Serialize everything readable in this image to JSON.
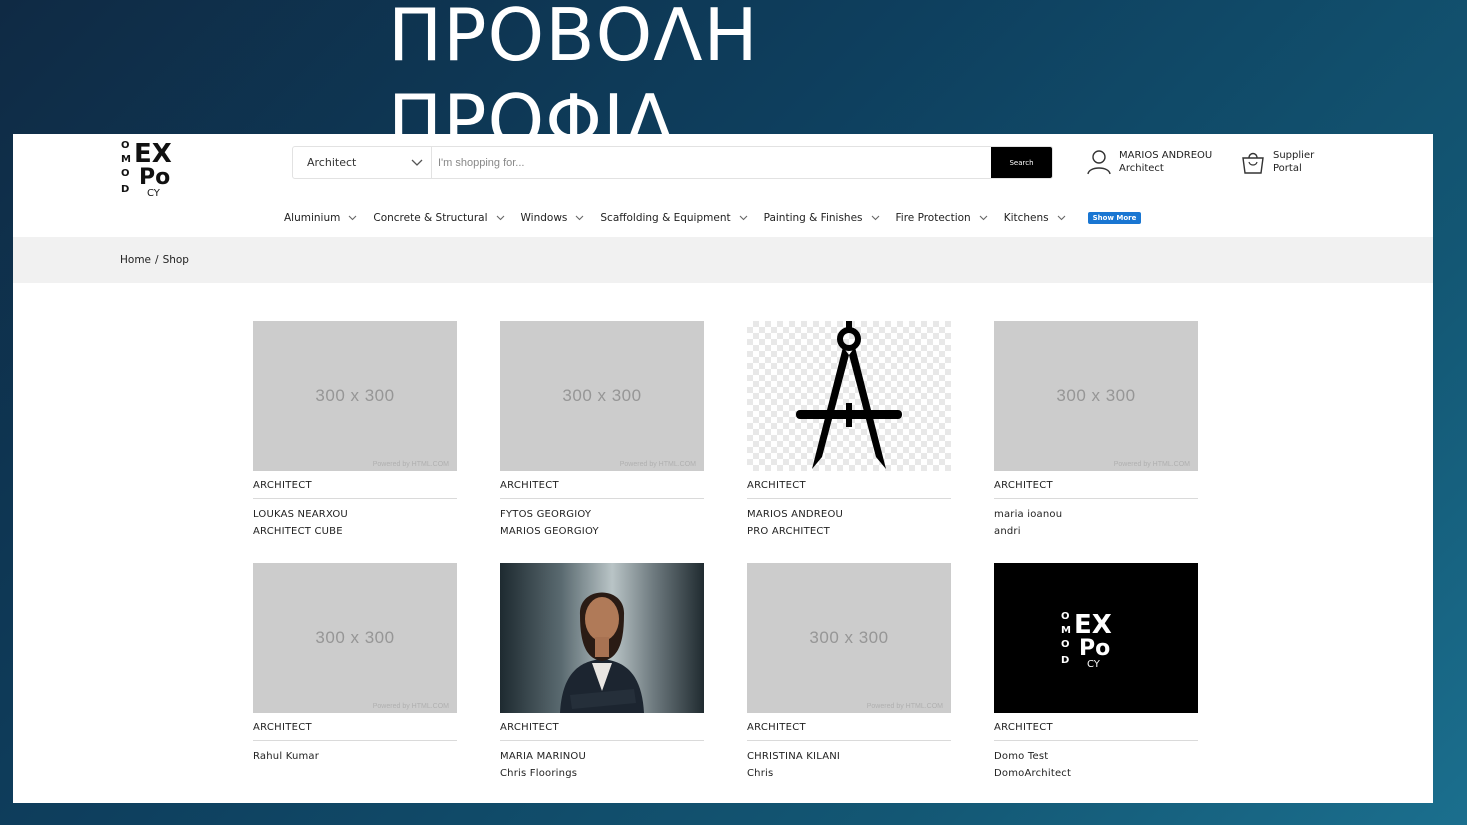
{
  "slide": {
    "title_line1": "ΠΡΟΒΟΛΗ",
    "title_line2": "ΠΡΟΦΙΛ"
  },
  "header": {
    "logo_alt": "DOMO EXPO CY",
    "category_select": "Architect",
    "search_placeholder": "I'm shopping for...",
    "search_button": "Search",
    "user_name": "MARIOS ANDREOU",
    "user_role": "Architect",
    "supplier_line1": "Supplier",
    "supplier_line2": "Portal"
  },
  "nav": [
    {
      "label": "Aluminium"
    },
    {
      "label": "Concrete & Structural"
    },
    {
      "label": "Windows"
    },
    {
      "label": "Scaffolding & Equipment"
    },
    {
      "label": "Painting & Finishes"
    },
    {
      "label": "Fire Protection"
    },
    {
      "label": "Kitchens"
    }
  ],
  "show_more": "Show More",
  "breadcrumb": {
    "home": "Home",
    "sep": "/",
    "current": "Shop"
  },
  "placeholder": {
    "size": "300 x 300",
    "powered": "Powered by HTML.COM"
  },
  "cards": [
    {
      "category": "ARCHITECT",
      "line1": "LOUKAS NEARXOU",
      "line2": "ARCHITECT CUBE",
      "image": "placeholder"
    },
    {
      "category": "ARCHITECT",
      "line1": "FYTOS GEORGIOY",
      "line2": "MARIOS GEORGIOY",
      "image": "placeholder"
    },
    {
      "category": "ARCHITECT",
      "line1": "MARIOS ANDREOU",
      "line2": "PRO ARCHITECT",
      "image": "compass-icon"
    },
    {
      "category": "ARCHITECT",
      "line1": "maria ioanou",
      "line2": "andri",
      "image": "placeholder"
    },
    {
      "category": "ARCHITECT",
      "line1": "Rahul Kumar",
      "line2": "",
      "image": "placeholder"
    },
    {
      "category": "ARCHITECT",
      "line1": "MARIA MARINOU",
      "line2": "Chris Floorings",
      "image": "portrait-photo"
    },
    {
      "category": "ARCHITECT",
      "line1": "CHRISTINA KILANI",
      "line2": "Chris",
      "image": "placeholder"
    },
    {
      "category": "ARCHITECT",
      "line1": "Domo Test",
      "line2": "DomoArchitect",
      "image": "logo"
    }
  ],
  "colors": {
    "accent": "#1976d2",
    "search_button": "#000000",
    "breadcrumb_bg": "#f1f1f1",
    "placeholder_bg": "#cccccc"
  }
}
